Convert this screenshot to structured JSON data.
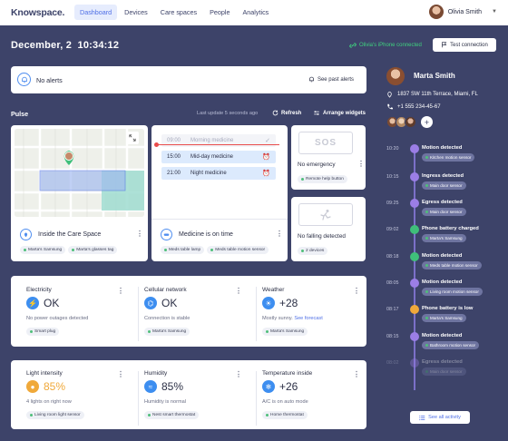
{
  "app": {
    "logo": "Knowspace."
  },
  "nav": {
    "items": [
      "Dashboard",
      "Devices",
      "Care spaces",
      "People",
      "Analytics"
    ],
    "active": "Dashboard"
  },
  "user": {
    "name": "Olivia Smith"
  },
  "header": {
    "date": "December, 2",
    "time": "10:34:12",
    "phone_status": "Olivia's iPhone connected",
    "test_button": "Test connection"
  },
  "alerts": {
    "text": "No alerts",
    "past_button": "See past alerts"
  },
  "pulse": {
    "title": "Pulse",
    "last_update": "Last update 5 seconds ago",
    "refresh": "Refresh",
    "arrange": "Arrange widgets"
  },
  "cards": {
    "location": {
      "title": "Inside the Care Space",
      "tags": [
        "Marta's Samsung",
        "Marta's glasses tag"
      ]
    },
    "medicine": {
      "title": "Medicine is on time",
      "rows": [
        {
          "time": "09:00",
          "name": "Morning medicine",
          "status": "done"
        },
        {
          "time": "15:00",
          "name": "Mid-day medicine",
          "status": "scheduled"
        },
        {
          "time": "21:00",
          "name": "Night medicine",
          "status": "scheduled"
        }
      ],
      "tags": [
        "Meds table lamp",
        "Meds table motion sensor"
      ]
    },
    "sos": {
      "box": "SOS",
      "title": "No emergency",
      "tag": "Remote help button"
    },
    "fall": {
      "title": "No falling detected",
      "tag": "2 devices"
    },
    "electricity": {
      "label": "Electricity",
      "value": "OK",
      "sub": "No power outages detected",
      "tag": "Smart plug"
    },
    "cellular": {
      "label": "Cellular network",
      "value": "OK",
      "sub": "Connection is stable",
      "tag": "Marta's Samsung"
    },
    "weather": {
      "label": "Weather",
      "value": "+28",
      "sub": "Mostly sunny.",
      "sub_link": "See forecast",
      "tag": "Marta's Samsung"
    },
    "light": {
      "label": "Light intensity",
      "value": "85%",
      "sub": "4 lights on right now",
      "tag": "Living room light sensor"
    },
    "humidity": {
      "label": "Humidity",
      "value": "85%",
      "sub": "Humidity is normal",
      "tag": "Nest smart thermostat"
    },
    "temperature": {
      "label": "Temperature inside",
      "value": "+26",
      "sub": "A/C is on auto mode",
      "tag": "Home thermostat"
    }
  },
  "profile": {
    "name": "Marta Smith",
    "address": "1837 SW 11th Terrace, Miami, FL",
    "phone": "+1 555 234-45-67"
  },
  "timeline": [
    {
      "time": "10:20",
      "title": "Motion detected",
      "tag": "Kitchen motion sensor",
      "dot": "#9b7ee6"
    },
    {
      "time": "10:15",
      "title": "Ingress detected",
      "tag": "Main door sensor",
      "dot": "#9b7ee6"
    },
    {
      "time": "09:25",
      "title": "Egress detected",
      "tag": "Main door sensor",
      "dot": "#9b7ee6"
    },
    {
      "time": "09:02",
      "title": "Phone battery charged",
      "tag": "Marta's Samsung",
      "dot": "#3fbf7a"
    },
    {
      "time": "08:18",
      "title": "Motion detected",
      "tag": "Meds table motion sensor",
      "dot": "#3fbf7a"
    },
    {
      "time": "08:05",
      "title": "Motion detected",
      "tag": "Living room motion sensor",
      "dot": "#9b7ee6"
    },
    {
      "time": "08:17",
      "title": "Phone battery is low",
      "tag": "Marta's Samsung",
      "dot": "#f0a93a"
    },
    {
      "time": "08:15",
      "title": "Motion detected",
      "tag": "Bathroom motion sensor",
      "dot": "#9b7ee6"
    },
    {
      "time": "08:02",
      "title": "Egress detected",
      "tag": "Main door sensor",
      "dot": "#9b7ee6"
    }
  ],
  "see_all": "See all activity",
  "colors": {
    "background": "#3d4369",
    "accent": "#4f6fe6",
    "success": "#3fd27f",
    "warning": "#f0a93a"
  }
}
